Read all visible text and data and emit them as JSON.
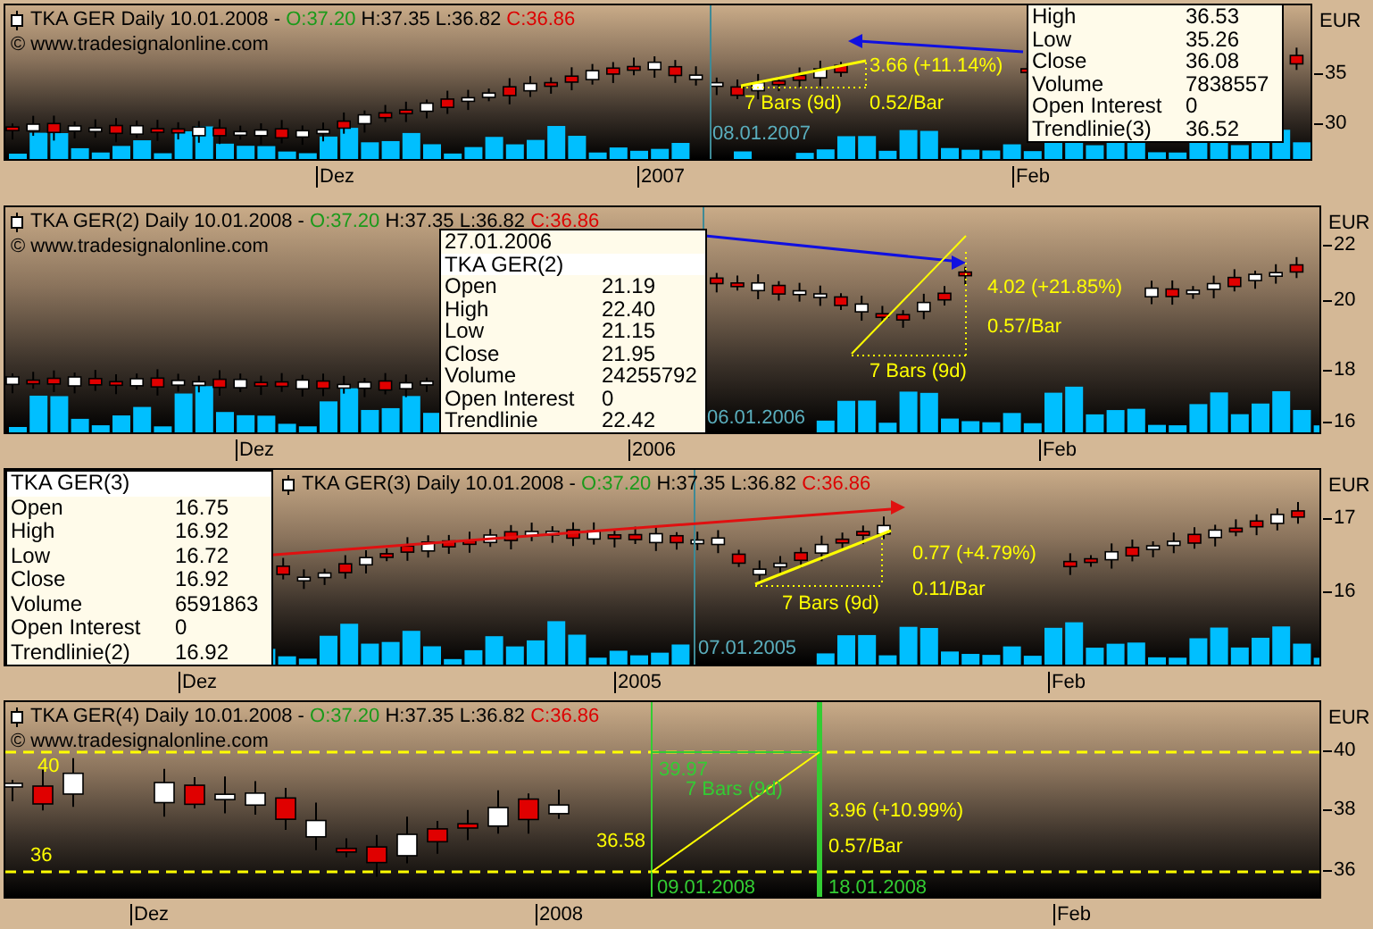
{
  "panels": [
    {
      "header": {
        "title": "TKA GER Daily  10.01.2008 -",
        "open": "O:37.20",
        "high": "H:37.35",
        "low": "L:36.82",
        "close": "C:36.86"
      },
      "watermark": "© www.tradesignalonline.com",
      "currency": "EUR",
      "y_ticks": [
        "35",
        "30"
      ],
      "x_labels": [
        "Dez",
        "2007",
        "Feb"
      ],
      "annotations": [
        {
          "text": "3.66 (+11.14%)",
          "color": "#ffff00"
        },
        {
          "text": "7 Bars (9d)",
          "color": "#ffff00"
        },
        {
          "text": "0.52/Bar",
          "color": "#ffff00"
        },
        {
          "text": "08.01.2007",
          "color": "#5aaebd"
        }
      ],
      "info_box": {
        "rows": [
          {
            "label": "High",
            "value": "36.53"
          },
          {
            "label": "Low",
            "value": "35.26"
          },
          {
            "label": "Close",
            "value": "36.08"
          },
          {
            "label": "Volume",
            "value": "7838557"
          },
          {
            "label": "Open Interest",
            "value": "0"
          },
          {
            "label": "Trendlinie(3)",
            "value": "36.52"
          }
        ]
      }
    },
    {
      "header": {
        "title": "TKA GER(2) Daily  10.01.2008 -",
        "open": "O:37.20",
        "high": "H:37.35",
        "low": "L:36.82",
        "close": "C:36.86"
      },
      "watermark": "© www.tradesignalonline.com",
      "currency": "EUR",
      "y_ticks": [
        "22",
        "20",
        "18",
        "16"
      ],
      "x_labels": [
        "Dez",
        "2006",
        "Feb"
      ],
      "annotations": [
        {
          "text": "4.02 (+21.85%)",
          "color": "#ffff00"
        },
        {
          "text": "0.57/Bar",
          "color": "#ffff00"
        },
        {
          "text": "7 Bars (9d)",
          "color": "#ffff00"
        },
        {
          "text": "06.01.2006",
          "color": "#5aaebd"
        }
      ],
      "info_box": {
        "date": "27.01.2006",
        "title": "TKA GER(2)",
        "rows": [
          {
            "label": "Open",
            "value": "21.19"
          },
          {
            "label": "High",
            "value": "22.40"
          },
          {
            "label": "Low",
            "value": "21.15"
          },
          {
            "label": "Close",
            "value": "21.95"
          },
          {
            "label": "Volume",
            "value": "24255792"
          },
          {
            "label": "Open Interest",
            "value": "0"
          },
          {
            "label": "Trendlinie",
            "value": "22.42"
          }
        ]
      }
    },
    {
      "header": {
        "title": "TKA GER(3) Daily  10.01.2008 -",
        "open": "O:37.20",
        "high": "H:37.35",
        "low": "L:36.82",
        "close": "C:36.86"
      },
      "currency": "EUR",
      "y_ticks": [
        "17",
        "16"
      ],
      "x_labels": [
        "Dez",
        "2005",
        "Feb"
      ],
      "annotations": [
        {
          "text": "0.77 (+4.79%)",
          "color": "#ffff00"
        },
        {
          "text": "0.11/Bar",
          "color": "#ffff00"
        },
        {
          "text": "7 Bars (9d)",
          "color": "#ffff00"
        },
        {
          "text": "07.01.2005",
          "color": "#5aaebd"
        }
      ],
      "info_box": {
        "title": "TKA GER(3)",
        "rows": [
          {
            "label": "Open",
            "value": "16.75"
          },
          {
            "label": "High",
            "value": "16.92"
          },
          {
            "label": "Low",
            "value": "16.72"
          },
          {
            "label": "Close",
            "value": "16.92"
          },
          {
            "label": "Volume",
            "value": "6591863"
          },
          {
            "label": "Open Interest",
            "value": "0"
          },
          {
            "label": "Trendlinie(2)",
            "value": "16.92"
          }
        ]
      }
    },
    {
      "header": {
        "title": "TKA GER(4) Daily  10.01.2008 -",
        "open": "O:37.20",
        "high": "H:37.35",
        "low": "L:36.82",
        "close": "C:36.86"
      },
      "watermark": "© www.tradesignalonline.com",
      "currency": "EUR",
      "y_ticks": [
        "40",
        "38",
        "36"
      ],
      "x_labels": [
        "Dez",
        "2008",
        "Feb"
      ],
      "annotations": [
        {
          "text": "40",
          "color": "#ffff00"
        },
        {
          "text": "36",
          "color": "#ffff00"
        },
        {
          "text": "39.97",
          "color": "#33cc33"
        },
        {
          "text": "7 Bars (9d)",
          "color": "#33cc33"
        },
        {
          "text": "36.58",
          "color": "#ffff00"
        },
        {
          "text": "09.01.2008",
          "color": "#33cc33"
        },
        {
          "text": "3.96 (+10.99%)",
          "color": "#ffff00"
        },
        {
          "text": "0.57/Bar",
          "color": "#ffff00"
        },
        {
          "text": "18.01.2008",
          "color": "#33cc33"
        }
      ]
    }
  ]
}
